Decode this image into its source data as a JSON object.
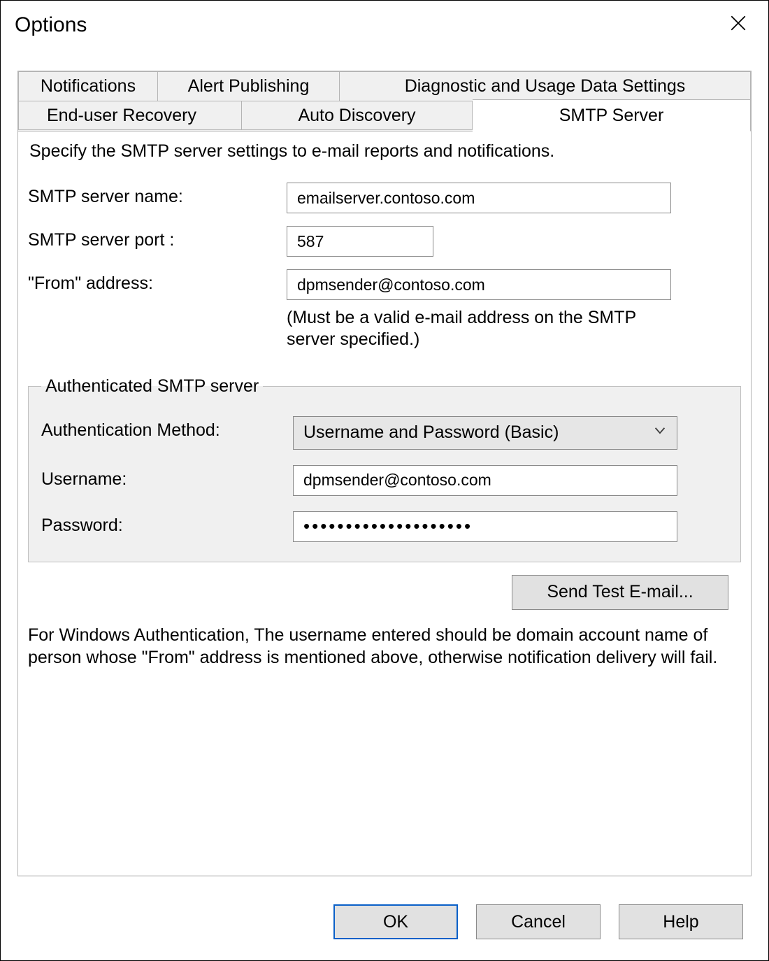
{
  "dialog": {
    "title": "Options"
  },
  "tabs": {
    "notifications": "Notifications",
    "alert_publishing": "Alert Publishing",
    "diag": "Diagnostic and Usage Data Settings",
    "end_user_recovery": "End-user Recovery",
    "auto_discovery": "Auto Discovery",
    "smtp_server": "SMTP Server"
  },
  "smtp": {
    "intro": "Specify the SMTP server settings to e-mail reports and notifications.",
    "server_name_label": "SMTP server name:",
    "server_name_value": "emailserver.contoso.com",
    "server_port_label": "SMTP server port :",
    "server_port_value": "587",
    "from_label": "\"From\" address:",
    "from_value": "dpmsender@contoso.com",
    "from_hint": "(Must be a valid e-mail address on the SMTP server specified.)"
  },
  "auth": {
    "legend": "Authenticated SMTP server",
    "method_label": "Authentication Method:",
    "method_value": "Username and Password (Basic)",
    "username_label": "Username:",
    "username_value": "dpmsender@contoso.com",
    "password_label": "Password:",
    "password_mask": "••••••••••••••••••••"
  },
  "buttons": {
    "send_test": "Send Test E-mail...",
    "ok": "OK",
    "cancel": "Cancel",
    "help": "Help"
  },
  "note": "For Windows Authentication, The username entered should be domain account name of person whose \"From\" address is mentioned above, otherwise notification delivery will fail."
}
